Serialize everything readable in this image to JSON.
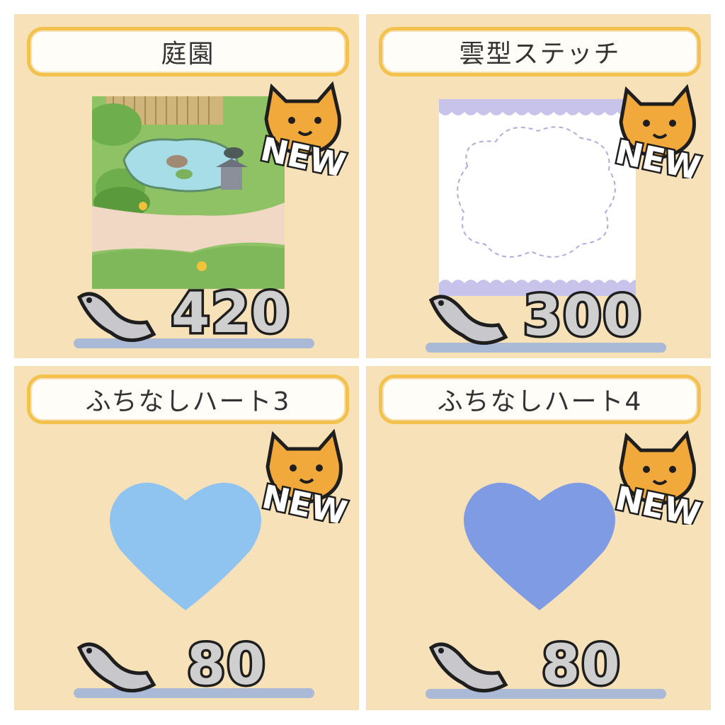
{
  "items": [
    {
      "title": "庭園",
      "price": "420",
      "badge": "NEW",
      "icon": "garden-thumbnail"
    },
    {
      "title": "雲型ステッチ",
      "price": "300",
      "badge": "NEW",
      "icon": "cloud-stitch-thumbnail"
    },
    {
      "title": "ふちなしハート3",
      "price": "80",
      "badge": "NEW",
      "icon": "heart-light-blue",
      "color": "#8fc4f0"
    },
    {
      "title": "ふちなしハート4",
      "price": "80",
      "badge": "NEW",
      "icon": "heart-periwinkle",
      "color": "#7e9be3"
    }
  ],
  "colors": {
    "card_bg": "#f7e1b8",
    "title_border": "#f2c24d",
    "bar": "#a9b9d6",
    "cat": "#f2a93b"
  }
}
